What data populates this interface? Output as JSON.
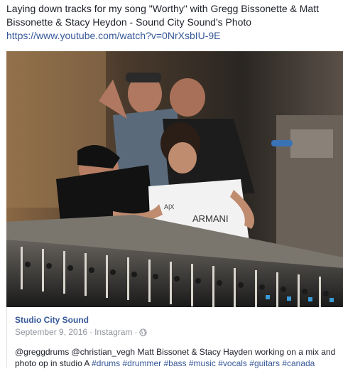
{
  "post": {
    "title_text": "Laying down tracks for my song \"Worthy\" with Gregg Bissonette & Matt Bissonette & Stacy Heydon - Sound City Sound's Photo",
    "link": "https://www.youtube.com/watch?v=0NrXsbIU-9E"
  },
  "photo": {
    "shirt_text": "ARMANI",
    "shirt_initials": "A|X"
  },
  "attachment": {
    "source_name": "Studio City Sound",
    "date": "September 9, 2016",
    "separator": "·",
    "platform": "Instagram",
    "separator2": "·",
    "caption_text": "@greggdrums @christian_vegh Matt Bissonet & Stacy Hayden working on a mix and photo op in studio A",
    "hashtags": [
      "#drums",
      "#drummer",
      "#bass",
      "#music",
      "#vocals",
      "#guitars",
      "#canada"
    ]
  }
}
